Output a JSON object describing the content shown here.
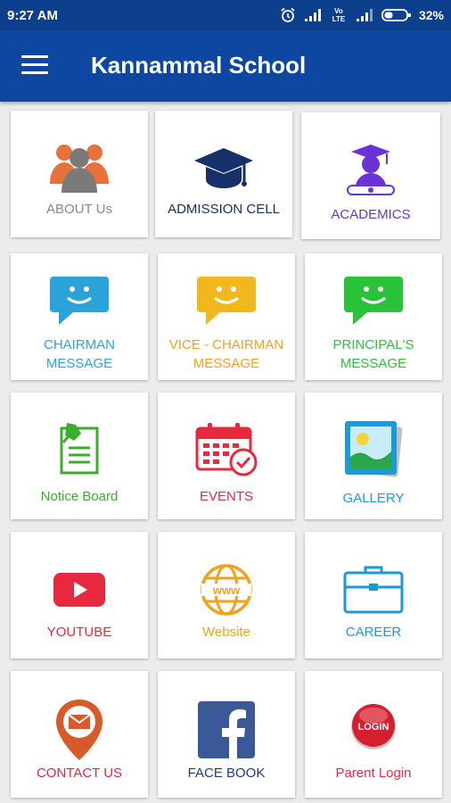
{
  "status": {
    "time": "9:27 AM",
    "battery": "32%",
    "net_label": "Vo LTE"
  },
  "header": {
    "title": "Kannammal School",
    "menu_icon": "hamburger-menu-icon"
  },
  "tiles": [
    {
      "label": "ABOUT Us",
      "icon": "people-group-icon",
      "color": "#888888"
    },
    {
      "label": "ADMISSION CELL",
      "icon": "graduation-cap-icon",
      "color": "#17306a"
    },
    {
      "label": "ACADEMICS",
      "icon": "graduate-icon",
      "color": "#6a33d6"
    },
    {
      "label": "CHAIRMAN MESSAGE",
      "icon": "chat-smile-icon",
      "color": "#29a3d8"
    },
    {
      "label": "VICE - CHAIRMAN MESSAGE",
      "icon": "chat-smile-icon",
      "color": "#f0a21c"
    },
    {
      "label": "PRINCIPAL'S MESSAGE",
      "icon": "chat-smile-icon",
      "color": "#29c23a"
    },
    {
      "label": "Notice Board",
      "icon": "notice-pin-icon",
      "color": "#3dae2b"
    },
    {
      "label": "EVENTS",
      "icon": "calendar-check-icon",
      "color": "#e8283e"
    },
    {
      "label": "GALLERY",
      "icon": "picture-icon",
      "color": "#1a9ad6"
    },
    {
      "label": "YOUTUBE",
      "icon": "youtube-play-icon",
      "color": "#e8283e"
    },
    {
      "label": "Website",
      "icon": "globe-www-icon",
      "color": "#f0a21c"
    },
    {
      "label": "CAREER",
      "icon": "briefcase-icon",
      "color": "#1a9ad6"
    },
    {
      "label": "CONTACT US",
      "icon": "mail-pin-icon",
      "color": "#e8283e"
    },
    {
      "label": "FACE BOOK",
      "icon": "facebook-icon",
      "color": "#1f3a8a"
    },
    {
      "label": "Parent Login",
      "icon": "login-button-icon",
      "color": "#e8283e"
    }
  ]
}
